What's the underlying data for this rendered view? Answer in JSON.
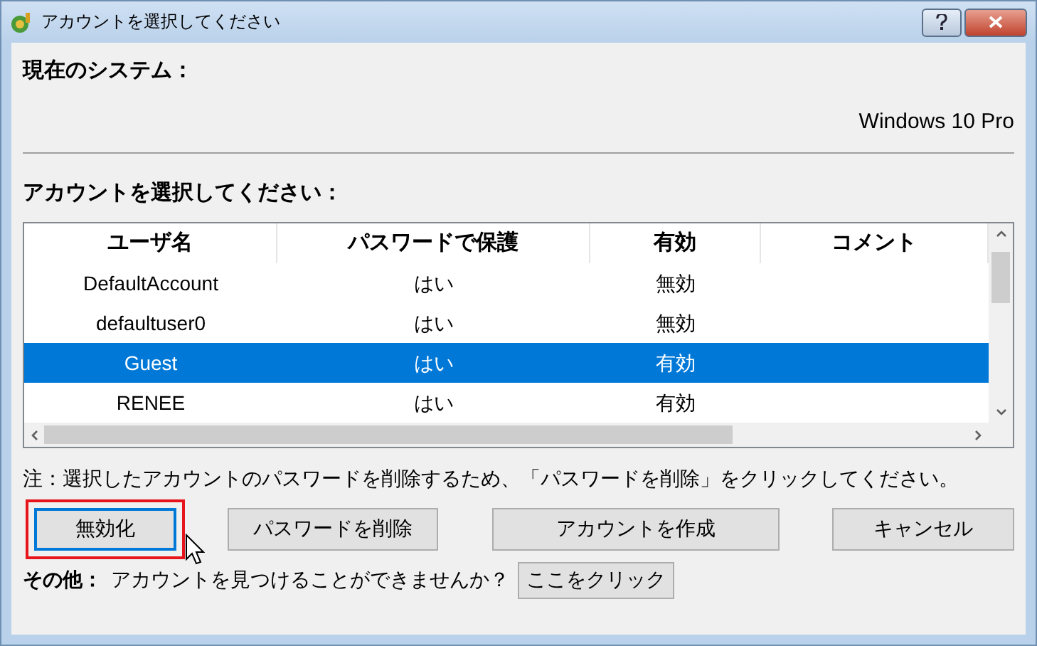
{
  "window": {
    "title": "アカウントを選択してください"
  },
  "current_system": {
    "label": "現在のシステム：",
    "value": "Windows 10 Pro"
  },
  "account_prompt": "アカウントを選択してください：",
  "table": {
    "columns": [
      "ユーザ名",
      "パスワードで保護",
      "有効",
      "コメント"
    ],
    "rows": [
      {
        "cells": [
          "DefaultAccount",
          "はい",
          "無効",
          ""
        ],
        "selected": false
      },
      {
        "cells": [
          "defaultuser0",
          "はい",
          "無効",
          ""
        ],
        "selected": false
      },
      {
        "cells": [
          "Guest",
          "はい",
          "有効",
          ""
        ],
        "selected": true
      },
      {
        "cells": [
          "RENEE",
          "はい",
          "有効",
          ""
        ],
        "selected": false
      }
    ]
  },
  "note": "注：選択したアカウントのパスワードを削除するため、「パスワードを削除」をクリックしてください。",
  "buttons": [
    {
      "label": "無効化",
      "focused": true,
      "highlighted": true
    },
    {
      "label": "パスワードを削除",
      "focused": false,
      "highlighted": false
    },
    {
      "label": "アカウントを作成",
      "focused": false,
      "highlighted": false
    },
    {
      "label": "キャンセル",
      "focused": false,
      "highlighted": false
    }
  ],
  "footer": {
    "label": "その他：",
    "question": "アカウントを見つけることができませんか？",
    "link_button": "ここをクリック"
  }
}
